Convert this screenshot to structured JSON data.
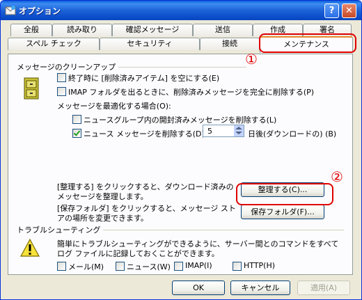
{
  "window": {
    "title": "オプション",
    "help_label": "?",
    "close_label": "✕"
  },
  "tabs_row1": [
    {
      "label": "全般"
    },
    {
      "label": "読み取り"
    },
    {
      "label": "確認メッセージ"
    },
    {
      "label": "送信"
    },
    {
      "label": "作成"
    },
    {
      "label": "署名"
    }
  ],
  "tabs_row2": [
    {
      "label": "スペル チェック"
    },
    {
      "label": "セキュリティ"
    },
    {
      "label": "接続"
    },
    {
      "label": "メンテナンス"
    }
  ],
  "cleanup": {
    "heading": "メッセージのクリーンアップ",
    "empty_deleted": {
      "label": "終了時に [削除済みアイテム] を空にする(E)",
      "checked": false
    },
    "imap_purge": {
      "label": "IMAP フォルダを出るときに、削除済みメッセージを完全に削除する(P)",
      "checked": false
    },
    "optimize_label": "メッセージを最適化する場合(O):",
    "delete_read_news": {
      "label": "ニュースグループ内の開封済みメッセージを削除する(L)",
      "checked": false
    },
    "delete_news": {
      "label": "ニュース メッセージを削除する(D)",
      "checked": true
    },
    "days_value": "5",
    "days_suffix": "日後(ダウンロードの) (B)",
    "cleanup_desc": "[整理する] をクリックすると、ダウンロード済みのメッセージを整理します。",
    "cleanup_button": "整理する(C)...",
    "store_desc": "[保存フォルダ] をクリックすると、メッセージ ストアの場所を変更できます。",
    "store_button": "保存フォルダ(F)..."
  },
  "troubleshoot": {
    "heading": "トラブルシューティング",
    "desc": "簡単にトラブルシューティングができるように、サーバー間とのコマンドをすべてログ ファイルに記録しておくことができます。",
    "options": [
      {
        "label": "メール(M)",
        "checked": false
      },
      {
        "label": "ニュース(W)",
        "checked": false
      },
      {
        "label": "IMAP(I)",
        "checked": false
      },
      {
        "label": "HTTP(H)",
        "checked": false
      }
    ]
  },
  "footer": {
    "ok": "OK",
    "cancel": "キャンセル",
    "apply": "適用(A)"
  },
  "annotations": {
    "marker1": "①",
    "marker2": "②"
  },
  "colors": {
    "callout": "#e00000",
    "titlebar": "#0b4cc9",
    "active_tab_accent": "#e68b2c"
  }
}
